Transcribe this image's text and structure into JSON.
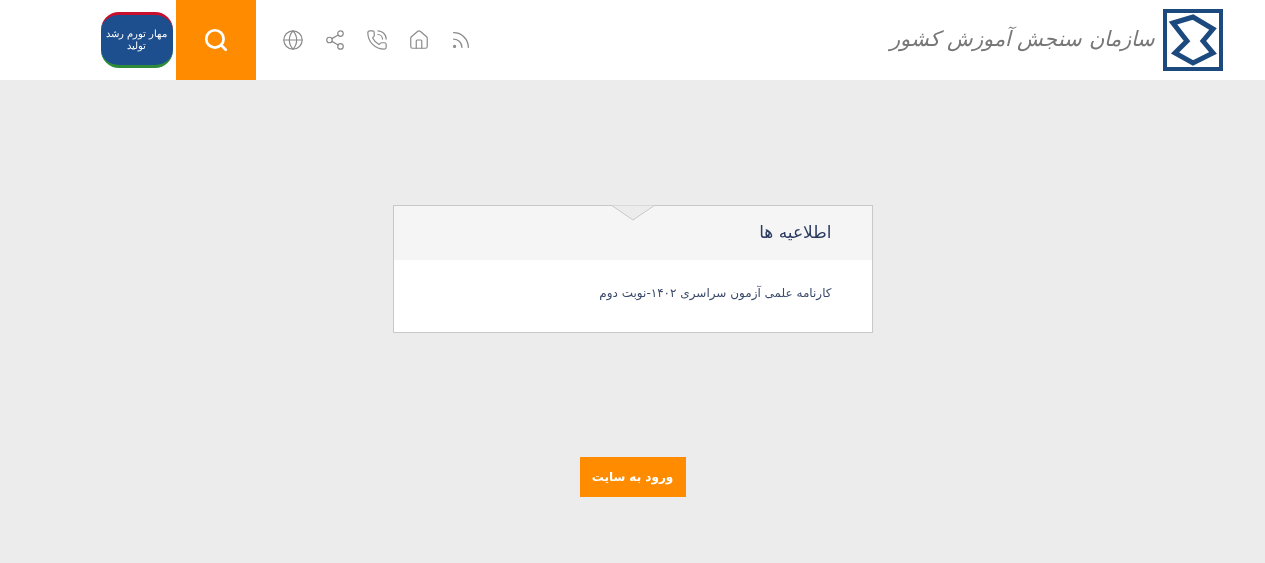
{
  "header": {
    "logo_text": "سازمان سنجش آموزش کشور",
    "emblem_text": "مهار تورم رشد تولید"
  },
  "notices": {
    "title": "اطلاعیه ها",
    "items": [
      {
        "text": "کارنامه علمی آزمون سراسری ۱۴۰۲-نوبت دوم"
      }
    ]
  },
  "enter_button": "ورود به سایت"
}
